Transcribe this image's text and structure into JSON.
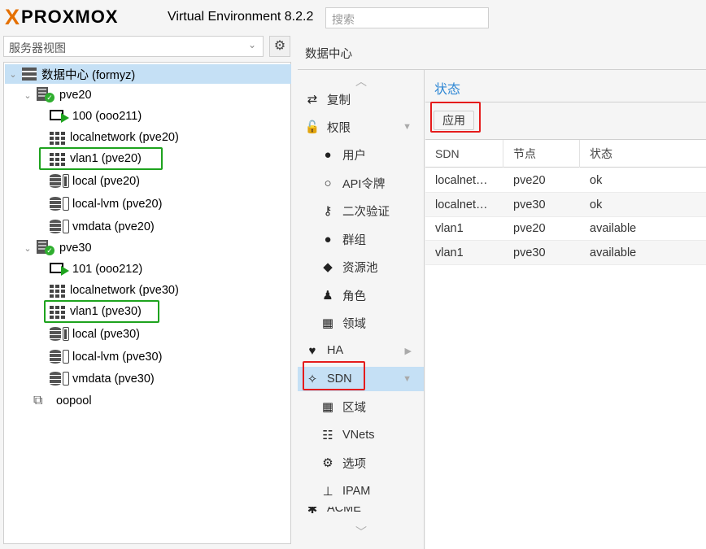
{
  "header": {
    "logo_x": "X",
    "logo_word": "PROXMOX",
    "product": "Virtual Environment 8.2.2",
    "search_placeholder": "搜索"
  },
  "left": {
    "view_selector": "服务器视图",
    "tree": {
      "root": "数据中心 (formyz)",
      "nodes": [
        {
          "name": "pve20",
          "children": [
            {
              "type": "vm",
              "label": "100 (ooo211)"
            },
            {
              "type": "grid",
              "label": "localnetwork (pve20)"
            },
            {
              "type": "grid",
              "label": "vlan1 (pve20)"
            },
            {
              "type": "storage",
              "label": "local (pve20)"
            },
            {
              "type": "storage",
              "label": "local-lvm (pve20)"
            },
            {
              "type": "storage",
              "label": "vmdata (pve20)"
            }
          ]
        },
        {
          "name": "pve30",
          "children": [
            {
              "type": "vm",
              "label": "101 (ooo212)"
            },
            {
              "type": "grid",
              "label": "localnetwork (pve30)"
            },
            {
              "type": "grid",
              "label": "vlan1 (pve30)"
            },
            {
              "type": "storage",
              "label": "local (pve30)"
            },
            {
              "type": "storage",
              "label": "local-lvm (pve30)"
            },
            {
              "type": "storage",
              "label": "vmdata (pve30)"
            }
          ]
        }
      ],
      "pool": "oopool"
    }
  },
  "content": {
    "title": "数据中心"
  },
  "menu": {
    "items": [
      {
        "label": "复制",
        "icon": "retweet-icon"
      },
      {
        "label": "权限",
        "icon": "unlock-icon"
      },
      {
        "label": "用户",
        "icon": "user-icon"
      },
      {
        "label": "API令牌",
        "icon": "user-outline-icon"
      },
      {
        "label": "二次验证",
        "icon": "key-icon"
      },
      {
        "label": "群组",
        "icon": "users-icon"
      },
      {
        "label": "资源池",
        "icon": "tags-icon"
      },
      {
        "label": "角色",
        "icon": "male-icon"
      },
      {
        "label": "领域",
        "icon": "address-book-icon"
      },
      {
        "label": "HA",
        "icon": "heartbeat-icon"
      },
      {
        "label": "SDN",
        "icon": "sdn-icon"
      },
      {
        "label": "区域",
        "icon": "grid-icon"
      },
      {
        "label": "VNets",
        "icon": "sitemap-icon"
      },
      {
        "label": "选项",
        "icon": "gear-icon"
      },
      {
        "label": "IPAM",
        "icon": "ipam-icon"
      },
      {
        "label": "ACME",
        "icon": "certificate-icon"
      }
    ]
  },
  "panel": {
    "title": "状态",
    "apply_label": "应用",
    "columns": [
      "SDN",
      "节点",
      "状态"
    ],
    "rows": [
      [
        "localnet…",
        "pve20",
        "ok"
      ],
      [
        "localnet…",
        "pve30",
        "ok"
      ],
      [
        "vlan1",
        "pve20",
        "available"
      ],
      [
        "vlan1",
        "pve30",
        "available"
      ]
    ]
  }
}
